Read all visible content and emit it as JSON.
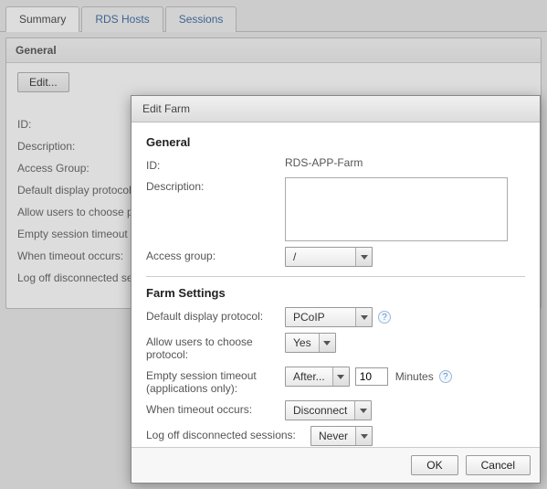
{
  "tabs": {
    "summary": "Summary",
    "rds_hosts": "RDS Hosts",
    "sessions": "Sessions"
  },
  "bg_panel": {
    "header": "General",
    "edit_label": "Edit...",
    "rows": {
      "id": "ID:",
      "description": "Description:",
      "access_group": "Access Group:",
      "default_protocol": "Default display protocol:",
      "allow_choose": "Allow users to choose protocol:",
      "empty_session": "Empty session timeout (applications only):",
      "when_timeout": "When timeout occurs:",
      "log_off": "Log off disconnected sessions:"
    }
  },
  "modal": {
    "title": "Edit Farm",
    "section_general": "General",
    "section_settings": "Farm Settings",
    "labels": {
      "id": "ID:",
      "description": "Description:",
      "access_group": "Access group:",
      "default_protocol": "Default display protocol:",
      "allow_choose": "Allow users to choose protocol:",
      "empty_session": "Empty session timeout (applications only):",
      "when_timeout": "When timeout occurs:",
      "log_off": "Log off disconnected sessions:"
    },
    "values": {
      "id": "RDS-APP-Farm",
      "description": "",
      "access_group": "/",
      "default_protocol": "PCoIP",
      "allow_choose": "Yes",
      "empty_session_mode": "After...",
      "empty_session_value": "10",
      "empty_session_unit": "Minutes",
      "when_timeout": "Disconnect",
      "log_off": "Never"
    },
    "buttons": {
      "ok": "OK",
      "cancel": "Cancel"
    },
    "help_glyph": "?"
  }
}
